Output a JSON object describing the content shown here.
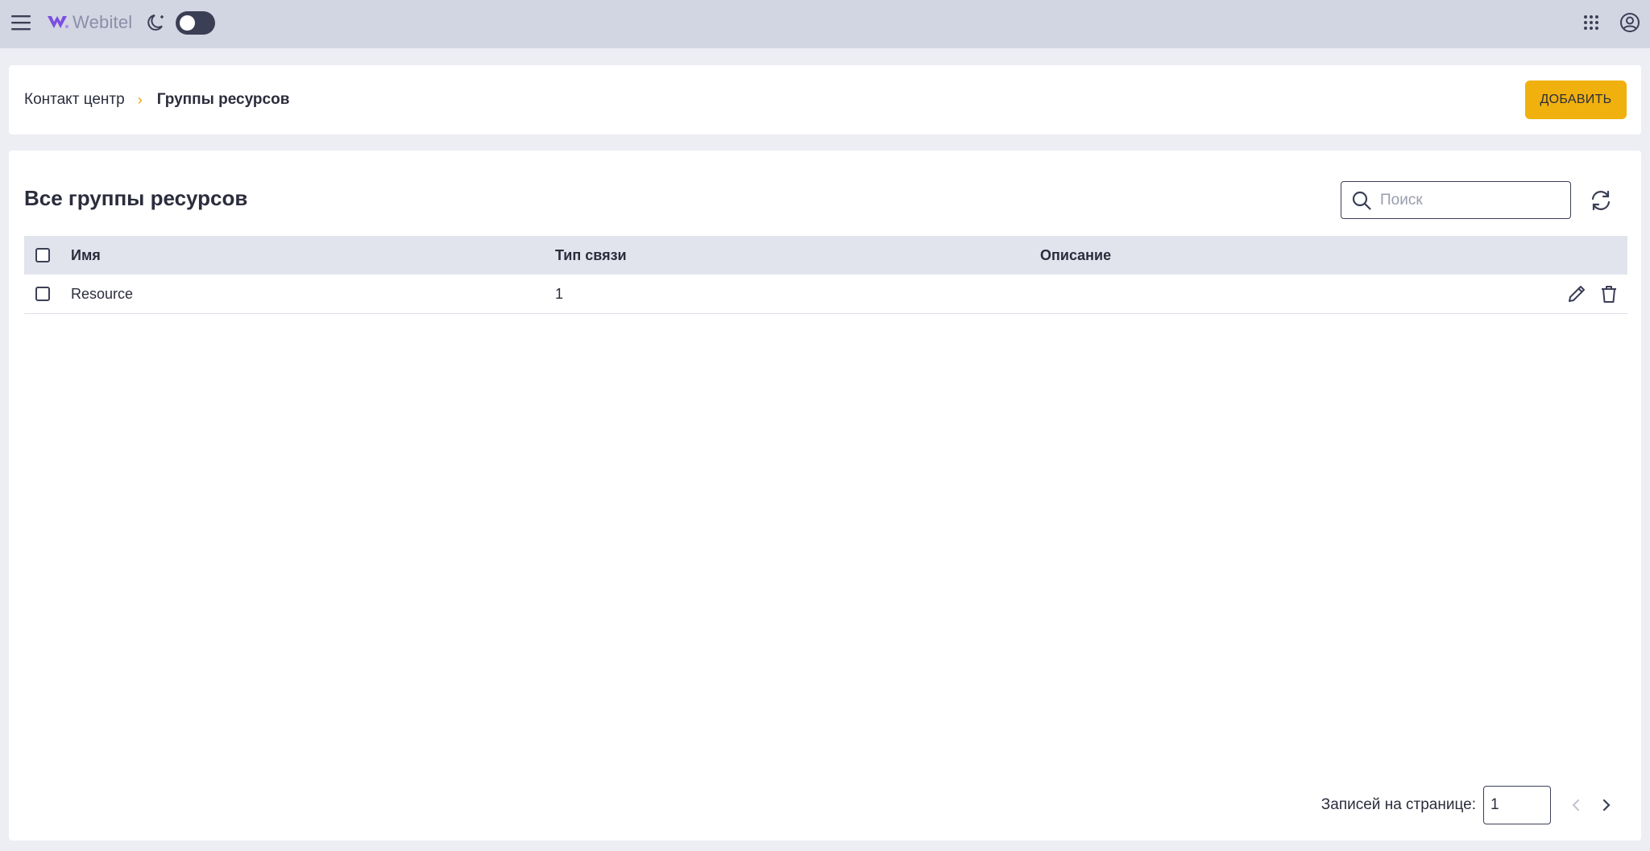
{
  "app": {
    "logo_text": "Webitel"
  },
  "topbar": {
    "menu_icon": "hamburger-menu-icon",
    "theme_icon": "moon-icon",
    "apps_icon": "apps-grid-icon",
    "account_icon": "account-circle-icon",
    "dark_mode_on": false
  },
  "breadcrumb": {
    "root": "Контакт центр",
    "separator": "›",
    "current": "Группы ресурсов"
  },
  "header": {
    "add_label": "ДОБАВИТЬ"
  },
  "section": {
    "title": "Все группы ресурсов"
  },
  "search": {
    "placeholder": "Поиск",
    "value": ""
  },
  "table": {
    "columns": [
      "Имя",
      "Тип связи",
      "Описание"
    ],
    "rows": [
      {
        "name": "Resource",
        "type": "1",
        "description": ""
      }
    ]
  },
  "pagination": {
    "label": "Записей на странице:",
    "per_page": "1"
  },
  "colors": {
    "accent": "#f0b10f",
    "topbar": "#d2d5e2",
    "header_row": "#e1e4ed",
    "brand_purple": "#7b4fe0"
  }
}
